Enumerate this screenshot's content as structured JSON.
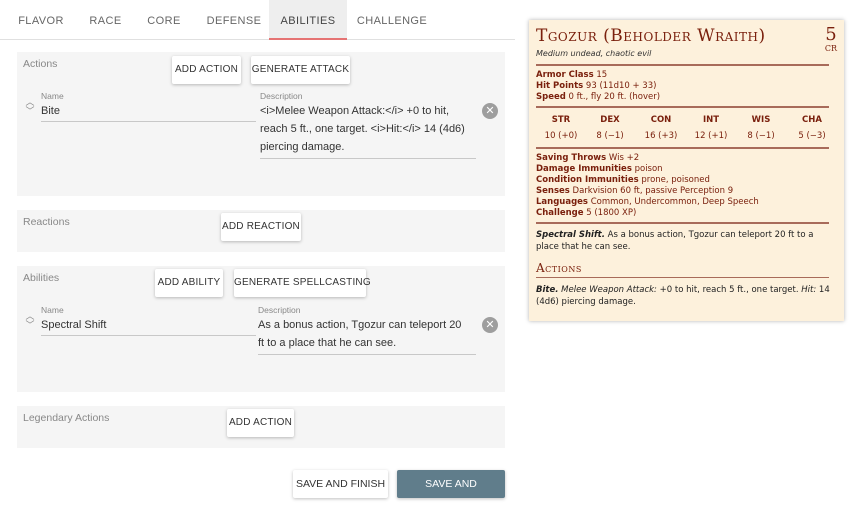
{
  "tabs": [
    {
      "label": "Flavor"
    },
    {
      "label": "Race"
    },
    {
      "label": "Core"
    },
    {
      "label": "Defense"
    },
    {
      "label": "Abilities",
      "active": true
    },
    {
      "label": "Challenge"
    }
  ],
  "actions": {
    "title": "Actions",
    "add_label": "Add Action",
    "generate_label": "Generate Attack",
    "name_label": "Name",
    "desc_label": "Description",
    "item": {
      "name": "Bite",
      "desc_lines": [
        "<i>Melee Weapon Attack:</i> +0 to hit,",
        "reach 5 ft., one target. <i>Hit:</i> 14 (4d6)",
        "piercing damage."
      ]
    }
  },
  "reactions": {
    "title": "Reactions",
    "add_label": "Add Reaction"
  },
  "abilities": {
    "title": "Abilities",
    "add_label": "Add Ability",
    "generate_label": "Generate Spellcasting",
    "name_label": "Name",
    "desc_label": "Description",
    "item": {
      "name": "Spectral Shift",
      "desc_lines": [
        "As a bonus action, Tgozur can teleport 20",
        "ft to a place that he can see."
      ]
    }
  },
  "legendary": {
    "title": "Legendary Actions",
    "add_label": "Add Action"
  },
  "footer": {
    "save_finish": "Save and Finish",
    "save_continue": "Save and Continue"
  },
  "statblock": {
    "name": "Tgozur (Beholder Wraith)",
    "cr_value": "5",
    "cr_label": "CR",
    "subtitle": "Medium undead, chaotic evil",
    "armor_class_label": "Armor Class",
    "armor_class": "15",
    "hit_points_label": "Hit Points",
    "hit_points": "93 (11d10 + 33)",
    "speed_label": "Speed",
    "speed": "0 ft., fly 20 ft. (hover)",
    "abilities": [
      {
        "name": "STR",
        "value": "10 (+0)"
      },
      {
        "name": "DEX",
        "value": "8 (−1)"
      },
      {
        "name": "CON",
        "value": "16 (+3)"
      },
      {
        "name": "INT",
        "value": "12 (+1)"
      },
      {
        "name": "WIS",
        "value": "8 (−1)"
      },
      {
        "name": "CHA",
        "value": "5 (−3)"
      }
    ],
    "saving_throws_label": "Saving Throws",
    "saving_throws": "Wis +2",
    "damage_immunities_label": "Damage Immunities",
    "damage_immunities": "poison",
    "condition_immunities_label": "Condition Immunities",
    "condition_immunities": "prone, poisoned",
    "senses_label": "Senses",
    "senses": "Darkvision 60 ft, passive Perception 9",
    "languages_label": "Languages",
    "languages": "Common, Undercommon, Deep Speech",
    "challenge_label": "Challenge",
    "challenge": "5 (1800 XP)",
    "trait_name": "Spectral Shift.",
    "trait_text": "As a bonus action, Tgozur can teleport 20 ft to a place that he can see.",
    "actions_heading": "Actions",
    "action_name": "Bite.",
    "action_attack_type": "Melee Weapon Attack:",
    "action_text_1": "+0 to hit, reach 5 ft., one target.",
    "action_hit_label": "Hit:",
    "action_text_2": "14 (4d6) piercing damage."
  },
  "colors": {
    "accent_tab": "#e57373",
    "primary_button": "#607d8b",
    "stat_header": "#7a200d",
    "stat_bg": "#fdf1dc"
  }
}
